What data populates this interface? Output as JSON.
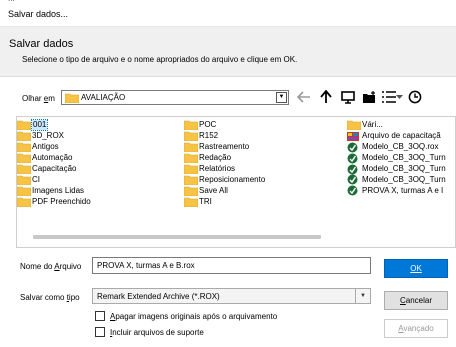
{
  "window": {
    "title": "Salvar dados..."
  },
  "header": {
    "title": "Salvar dados",
    "instruction": "Selecione o tipo de arquivo e o nome apropriados do arquivo e clique em OK."
  },
  "look_in": {
    "label_prefix": "Olhar ",
    "label_accel": "e",
    "label_suffix": "m",
    "value": "AVALIAÇÃO"
  },
  "files": {
    "column1": [
      {
        "name": "001",
        "icon": "folder-icon",
        "selected": true
      },
      {
        "name": "3D_ROX",
        "icon": "folder-icon"
      },
      {
        "name": "Antigos",
        "icon": "folder-icon"
      },
      {
        "name": "Automação",
        "icon": "folder-icon"
      },
      {
        "name": "Capacitação",
        "icon": "folder-icon"
      },
      {
        "name": "CI",
        "icon": "folder-icon"
      },
      {
        "name": "Imagens Lidas",
        "icon": "folder-icon"
      },
      {
        "name": "PDF Preenchido",
        "icon": "folder-icon"
      }
    ],
    "column2": [
      {
        "name": "POC",
        "icon": "folder-icon"
      },
      {
        "name": "R152",
        "icon": "folder-icon"
      },
      {
        "name": "Rastreamento",
        "icon": "folder-icon"
      },
      {
        "name": "Redação",
        "icon": "folder-icon"
      },
      {
        "name": "Relatórios",
        "icon": "folder-icon"
      },
      {
        "name": "Reposicionamento",
        "icon": "folder-icon"
      },
      {
        "name": "Save All",
        "icon": "folder-icon"
      },
      {
        "name": "TRI",
        "icon": "folder-icon"
      }
    ],
    "column3": [
      {
        "name": "Vári...",
        "icon": "folder-icon"
      },
      {
        "name": "Arquivo de capacitaçã",
        "icon": "rox-file-icon"
      },
      {
        "name": "Modelo_CB_3OQ.rox",
        "icon": "remark-file-icon"
      },
      {
        "name": "Modelo_CB_3OQ_Turn",
        "icon": "remark-file-icon"
      },
      {
        "name": "Modelo_CB_3OQ_Turn",
        "icon": "remark-file-icon"
      },
      {
        "name": "Modelo_CB_3OQ_Turn",
        "icon": "remark-file-icon"
      },
      {
        "name": "PROVA X, turmas A e I",
        "icon": "remark-file-icon"
      }
    ]
  },
  "form": {
    "name_label_prefix": "Nome do ",
    "name_label_accel": "A",
    "name_label_suffix": "rquivo",
    "name_value": "PROVA X, turmas A e B.rox",
    "type_label_prefix": "Salvar como ",
    "type_label_accel": "t",
    "type_label_suffix": "ipo",
    "type_value": "Remark Extended Archive (*.ROX)"
  },
  "options": {
    "delete_images_accel": "A",
    "delete_images_rest": "pagar imagens originais após o arquivamento",
    "include_support_accel": "I",
    "include_support_rest": "ncluir arquivos de suporte"
  },
  "buttons": {
    "ok": "OK",
    "cancel_accel": "C",
    "cancel_rest": "ancelar",
    "advanced_accel": "A",
    "advanced_rest": "vançado"
  },
  "colors": {
    "primary": "#0078d7",
    "folder": "#f6c344",
    "selection": "#cce8ff"
  }
}
